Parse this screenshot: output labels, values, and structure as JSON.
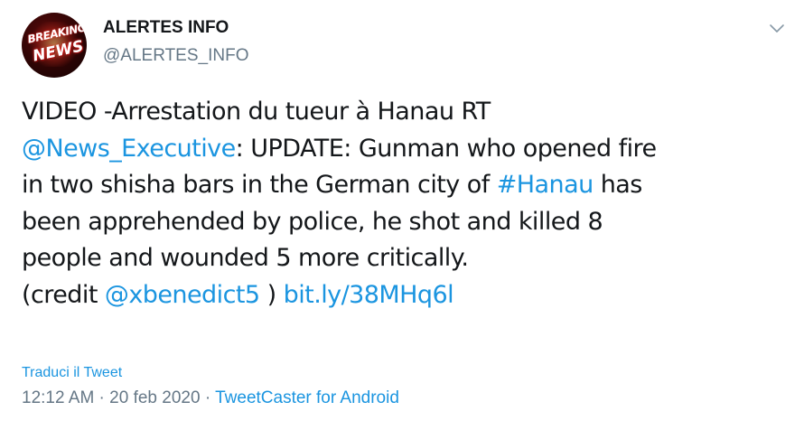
{
  "header": {
    "avatar_text_top": "BREAKING",
    "avatar_text_bottom": "NEWS",
    "display_name": "ALERTES INFO",
    "handle": "@ALERTES_INFO",
    "menu_icon": "chevron-down-icon"
  },
  "tweet": {
    "line1": "VIDEO -Arrestation du tueur à Hanau RT",
    "mention1": "@News_Executive",
    "line2_rest": ": UPDATE: Gunman who opened fire",
    "line3_start": "in two shisha bars in the German city of ",
    "hashtag": "#Hanau",
    "line3_end": " has",
    "line4": "been apprehended by police, he shot and killed 8",
    "line5": "people and wounded 5 more critically.",
    "line6_start": "(credit ",
    "mention2": "@xbenedict5",
    "line6_mid": " ) ",
    "url": "bit.ly/38MHq6l"
  },
  "footer": {
    "translate_label": "Traduci il Tweet",
    "time": "12:12 AM",
    "separator": " · ",
    "date": "20 feb 2020",
    "source": "TweetCaster for Android"
  },
  "colors": {
    "link": "#1b95e0",
    "secondary_text": "#657786",
    "primary_text": "#14171a"
  }
}
